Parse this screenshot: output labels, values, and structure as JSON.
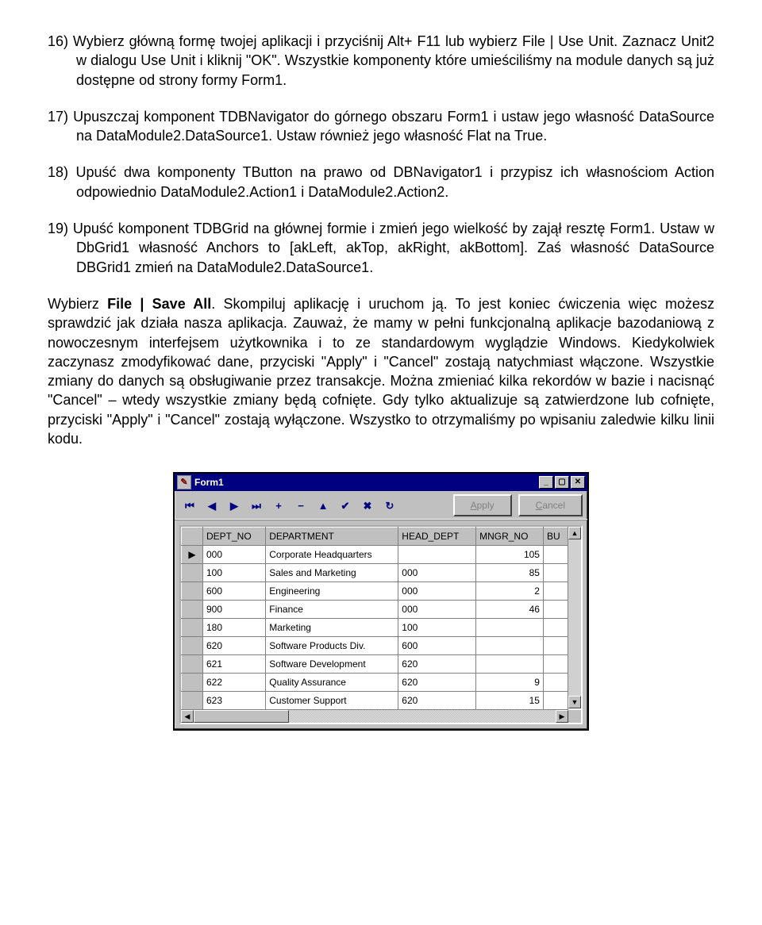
{
  "doc": {
    "p16": "16) Wybierz główną formę twojej aplikacji i przyciśnij Alt+ F11 lub wybierz File | Use Unit. Zaznacz Unit2 w dialogu Use Unit i kliknij \"OK\". Wszystkie komponenty które umieściliśmy na module danych  są już dostępne od strony formy  Form1.",
    "p17": "17) Upuszczaj komponent TDBNavigator do górnego obszaru Form1 i ustaw jego własność DataSource na DataModule2.DataSource1. Ustaw również jego własność Flat na  True.",
    "p18": "18) Upuść dwa komponenty TButton na prawo od DBNavigator1 i przypisz ich własnościom Action odpowiednio  DataModule2.Action1 i DataModule2.Action2.",
    "p19": "19) Upuść komponent TDBGrid na głównej formie i zmień jego wielkość by zajął resztę Form1. Ustaw w DbGrid1 własność Anchors to [akLeft, akTop, akRight, akBottom]. Zaś własność DataSource DBGrid1 zmień na DataModule2.DataSource1.",
    "plast_a": "Wybierz ",
    "plast_b": "File | Save All",
    "plast_c": ". Skompiluj aplikację i uruchom ją. To jest koniec ćwiczenia więc możesz sprawdzić jak działa nasza aplikacja. Zauważ, że mamy w pełni funkcjonalną aplikacje bazodaniową z nowoczesnym interfejsem użytkownika i to ze standardowym wyglądzie Windows. Kiedykolwiek zaczynasz zmodyfikować dane, przyciski  \"Apply\" i \"Cancel\" zostają natychmiast włączone.  Wszystkie zmiany do danych są obsługiwanie przez transakcje. Można zmieniać kilka rekordów w bazie i nacisnąć \"Cancel\" – wtedy wszystkie zmiany będą cofnięte. Gdy tylko aktualizuje są zatwierdzone lub cofnięte, przyciski \"Apply\" i \"Cancel\" zostają wyłączone. Wszystko to otrzymaliśmy po wpisaniu zaledwie kilku linii kodu."
  },
  "form": {
    "title": "Form1",
    "icon": "✎",
    "nav": {
      "first": "⏮",
      "prev": "◀",
      "next": "▶",
      "last": "⏭",
      "insert": "+",
      "delete": "−",
      "edit": "▲",
      "post": "✔",
      "cancel": "✖",
      "refresh": "↻"
    },
    "apply_pre": "A",
    "apply_rest": "pply",
    "cancel_pre": "C",
    "cancel_rest": "ancel",
    "columns": [
      "DEPT_NO",
      "DEPARTMENT",
      "HEAD_DEPT",
      "MNGR_NO",
      "BU"
    ],
    "rows": [
      {
        "marker": "▶",
        "c0": "000",
        "c1": "Corporate Headquarters",
        "c2": "",
        "c3": "105",
        "c4": ""
      },
      {
        "marker": "",
        "c0": "100",
        "c1": "Sales and Marketing",
        "c2": "000",
        "c3": "85",
        "c4": ""
      },
      {
        "marker": "",
        "c0": "600",
        "c1": "Engineering",
        "c2": "000",
        "c3": "2",
        "c4": ""
      },
      {
        "marker": "",
        "c0": "900",
        "c1": "Finance",
        "c2": "000",
        "c3": "46",
        "c4": ""
      },
      {
        "marker": "",
        "c0": "180",
        "c1": "Marketing",
        "c2": "100",
        "c3": "",
        "c4": ""
      },
      {
        "marker": "",
        "c0": "620",
        "c1": "Software Products Div.",
        "c2": "600",
        "c3": "",
        "c4": ""
      },
      {
        "marker": "",
        "c0": "621",
        "c1": "Software Development",
        "c2": "620",
        "c3": "",
        "c4": ""
      },
      {
        "marker": "",
        "c0": "622",
        "c1": "Quality Assurance",
        "c2": "620",
        "c3": "9",
        "c4": ""
      },
      {
        "marker": "",
        "c0": "623",
        "c1": "Customer Support",
        "c2": "620",
        "c3": "15",
        "c4": ""
      }
    ]
  }
}
